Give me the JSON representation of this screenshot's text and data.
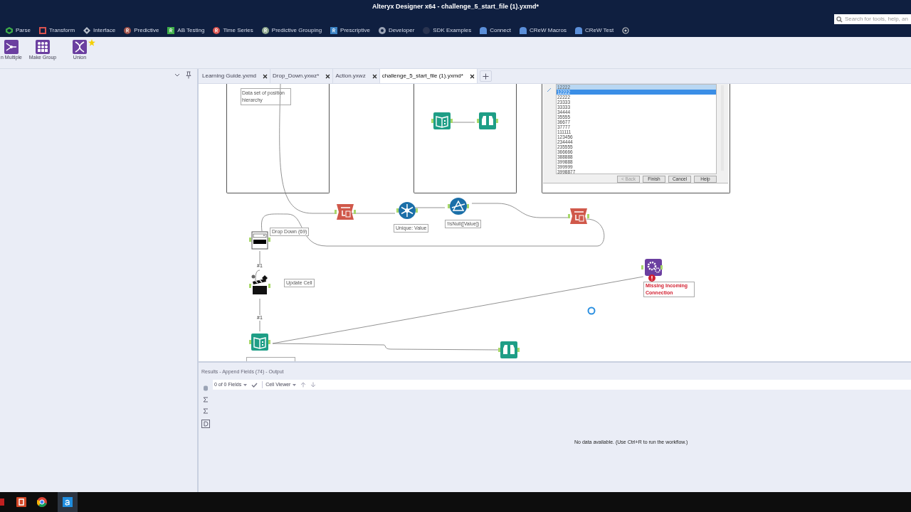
{
  "window": {
    "title": "Alteryx Designer x64 - challenge_5_start_file (1).yxmd*"
  },
  "search": {
    "placeholder": "Search for tools, help, an"
  },
  "ribbon_tabs": [
    {
      "label": "Parse",
      "kind": "hex",
      "color": "#3fae49"
    },
    {
      "label": "Transform",
      "kind": "square",
      "color": "#d9534f"
    },
    {
      "label": "Interface",
      "kind": "diamond",
      "color": "#b8bfcc"
    },
    {
      "label": "Predictive",
      "kind": "rcircle",
      "color": "#a0524a"
    },
    {
      "label": "AB Testing",
      "kind": "rsquare",
      "color": "#3fae49"
    },
    {
      "label": "Time Series",
      "kind": "rcircle",
      "color": "#d9534f"
    },
    {
      "label": "Predictive Grouping",
      "kind": "rcircle",
      "color": "#8fa88f"
    },
    {
      "label": "Prescriptive",
      "kind": "rsquare",
      "color": "#3b82c4"
    },
    {
      "label": "Developer",
      "kind": "gear",
      "color": "#9aa3b5"
    },
    {
      "label": "SDK Examples",
      "kind": "ring",
      "color": "#2a3450"
    },
    {
      "label": "Connect",
      "kind": "folder",
      "color": "#5b8fd9"
    },
    {
      "label": "CReW Macros",
      "kind": "folder",
      "color": "#5b8fd9"
    },
    {
      "label": "CReW Test",
      "kind": "folder",
      "color": "#5b8fd9"
    }
  ],
  "tools": [
    {
      "label": "n Multiple",
      "kind": "join"
    },
    {
      "label": "Make Group",
      "kind": "group"
    },
    {
      "label": "Union",
      "kind": "union",
      "favorite": true
    }
  ],
  "doc_tabs": [
    {
      "label": "Learning Guide.yxmd",
      "selected": false
    },
    {
      "label": "Drop_Down.yxwz*",
      "selected": false
    },
    {
      "label": "Action.yxwz",
      "selected": false
    },
    {
      "label": "challenge_5_start_file (1).yxmd*",
      "selected": true
    }
  ],
  "canvas": {
    "annotations": [
      {
        "text": "Data set of position hierarchy"
      }
    ],
    "nodes": [
      {
        "kind": "text-input"
      },
      {
        "kind": "browse"
      },
      {
        "kind": "crosstab"
      },
      {
        "kind": "unique",
        "label": "Unique: Value"
      },
      {
        "kind": "filter",
        "label": "!IsNull([Value])"
      },
      {
        "kind": "crosstab"
      },
      {
        "kind": "dropdown",
        "label": "Drop Down (69)"
      },
      {
        "kind": "action",
        "label": "Update Cell"
      },
      {
        "kind": "text-input"
      },
      {
        "kind": "browse"
      },
      {
        "kind": "macro",
        "label": "Missing Incoming Connection",
        "error": true
      }
    ],
    "link_labels": [
      "#1",
      "#1"
    ],
    "dialog": {
      "value": "12222",
      "items": [
        {
          "text": "12222",
          "selected": true
        },
        {
          "text": "22222",
          "selected": false
        },
        {
          "text": "23333",
          "selected": false
        },
        {
          "text": "33333",
          "selected": false
        },
        {
          "text": "34444",
          "selected": false
        },
        {
          "text": "35555",
          "selected": false
        },
        {
          "text": "36677",
          "selected": false
        },
        {
          "text": "37777",
          "selected": false
        },
        {
          "text": "111111",
          "selected": false
        },
        {
          "text": "123456",
          "selected": false
        },
        {
          "text": "234444",
          "selected": false
        },
        {
          "text": "235555",
          "selected": false
        },
        {
          "text": "366666",
          "selected": false
        },
        {
          "text": "388888",
          "selected": false
        },
        {
          "text": "399888",
          "selected": false
        },
        {
          "text": "399999",
          "selected": false
        },
        {
          "text": "3998877",
          "selected": false
        }
      ],
      "buttons": [
        "< Back",
        "Finish",
        "Cancel",
        "Help"
      ]
    }
  },
  "results": {
    "title": "Results - Append Fields (74) - Output",
    "fields": "0 of 0 Fields",
    "viewer": "Cell Viewer",
    "message": "No data available. (Use Ctrl+R to run the workflow.)"
  }
}
